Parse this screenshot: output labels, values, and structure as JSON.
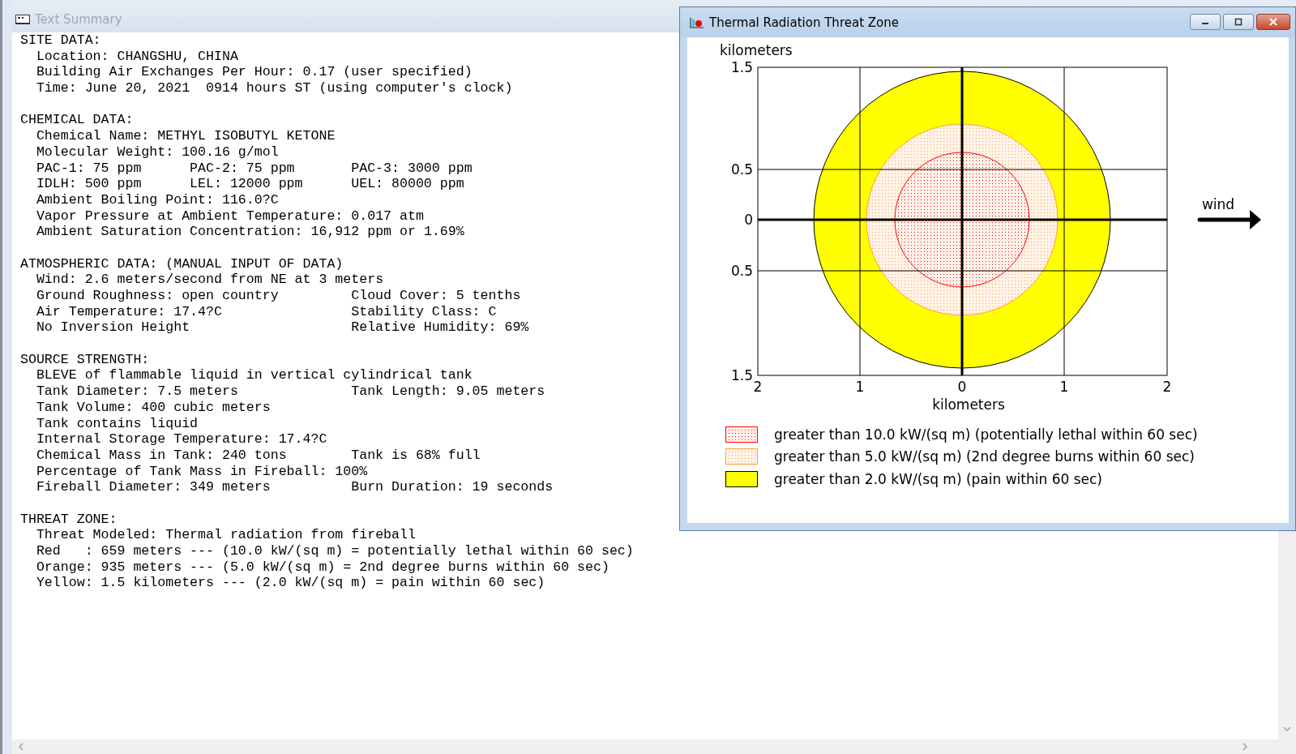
{
  "summary_window": {
    "title": "Text Summary",
    "sections": [
      {
        "heading": "SITE DATA:",
        "lines": [
          {
            "cells": [
              "Location: CHANGSHU, CHINA"
            ]
          },
          {
            "cells": [
              "Building Air Exchanges Per Hour: 0.17 (user specified)"
            ]
          },
          {
            "cells": [
              "Time: June 20, 2021  0914 hours ST (using computer's clock)"
            ]
          }
        ]
      },
      {
        "heading": "CHEMICAL DATA:",
        "lines": [
          {
            "cells": [
              "Chemical Name: METHYL ISOBUTYL KETONE"
            ]
          },
          {
            "cells": [
              "Molecular Weight: 100.16 g/mol"
            ]
          },
          {
            "cells": [
              "PAC-1: 75 ppm",
              "PAC-2: 75 ppm",
              "PAC-3: 3000 ppm"
            ]
          },
          {
            "cells": [
              "IDLH: 500 ppm",
              "LEL: 12000 ppm",
              "UEL: 80000 ppm"
            ]
          },
          {
            "cells": [
              "Ambient Boiling Point: 116.0?C"
            ]
          },
          {
            "cells": [
              "Vapor Pressure at Ambient Temperature: 0.017 atm"
            ]
          },
          {
            "cells": [
              "Ambient Saturation Concentration: 16,912 ppm or 1.69%"
            ]
          }
        ]
      },
      {
        "heading": "ATMOSPHERIC DATA: (MANUAL INPUT OF DATA)",
        "lines": [
          {
            "cells": [
              "Wind: 2.6 meters/second from NE at 3 meters"
            ]
          },
          {
            "cells": [
              "Ground Roughness: open country",
              "Cloud Cover: 5 tenths"
            ]
          },
          {
            "cells": [
              "Air Temperature: 17.4?C",
              "Stability Class: C"
            ]
          },
          {
            "cells": [
              "No Inversion Height",
              "Relative Humidity: 69%"
            ]
          }
        ]
      },
      {
        "heading": "SOURCE STRENGTH:",
        "lines": [
          {
            "cells": [
              "BLEVE of flammable liquid in vertical cylindrical tank"
            ]
          },
          {
            "cells": [
              "Tank Diameter: 7.5 meters",
              "Tank Length: 9.05 meters"
            ]
          },
          {
            "cells": [
              "Tank Volume: 400 cubic meters"
            ]
          },
          {
            "cells": [
              "Tank contains liquid"
            ]
          },
          {
            "cells": [
              "Internal Storage Temperature: 17.4?C"
            ]
          },
          {
            "cells": [
              "Chemical Mass in Tank: 240 tons",
              "Tank is 68% full"
            ]
          },
          {
            "cells": [
              "Percentage of Tank Mass in Fireball: 100%"
            ]
          },
          {
            "cells": [
              "Fireball Diameter: 349 meters",
              "Burn Duration: 19 seconds"
            ]
          }
        ]
      },
      {
        "heading": "THREAT ZONE:",
        "lines": [
          {
            "cells": [
              "Threat Modeled: Thermal radiation from fireball"
            ]
          },
          {
            "cells": [
              "Red   : 659 meters --- (10.0 kW/(sq m) = potentially lethal within 60 sec)"
            ]
          },
          {
            "cells": [
              "Orange: 935 meters --- (5.0 kW/(sq m) = 2nd degree burns within 60 sec)"
            ]
          },
          {
            "cells": [
              "Yellow: 1.5 kilometers --- (2.0 kW/(sq m) = pain within 60 sec)"
            ]
          }
        ]
      }
    ]
  },
  "threat_window": {
    "title": "Thermal Radiation Threat Zone",
    "plot": {
      "y_title": "kilometers",
      "x_title": "kilometers",
      "y_ticks": [
        "1.5",
        "0.5",
        "0",
        "0.5",
        "1.5"
      ],
      "x_ticks": [
        "2",
        "1",
        "0",
        "1",
        "2"
      ],
      "wind_label": "wind"
    },
    "zones": [
      {
        "label": "greater than 10.0 kW/(sq m) (potentially lethal within 60 sec)",
        "color": "#ff0000",
        "kind": "dotted"
      },
      {
        "label": "greater than 5.0 kW/(sq m) (2nd degree burns within 60 sec)",
        "color": "#ffa030",
        "kind": "dotted"
      },
      {
        "label": "greater than 2.0 kW/(sq m) (pain within 60 sec)",
        "color": "#ffff00",
        "kind": "solid"
      }
    ]
  }
}
